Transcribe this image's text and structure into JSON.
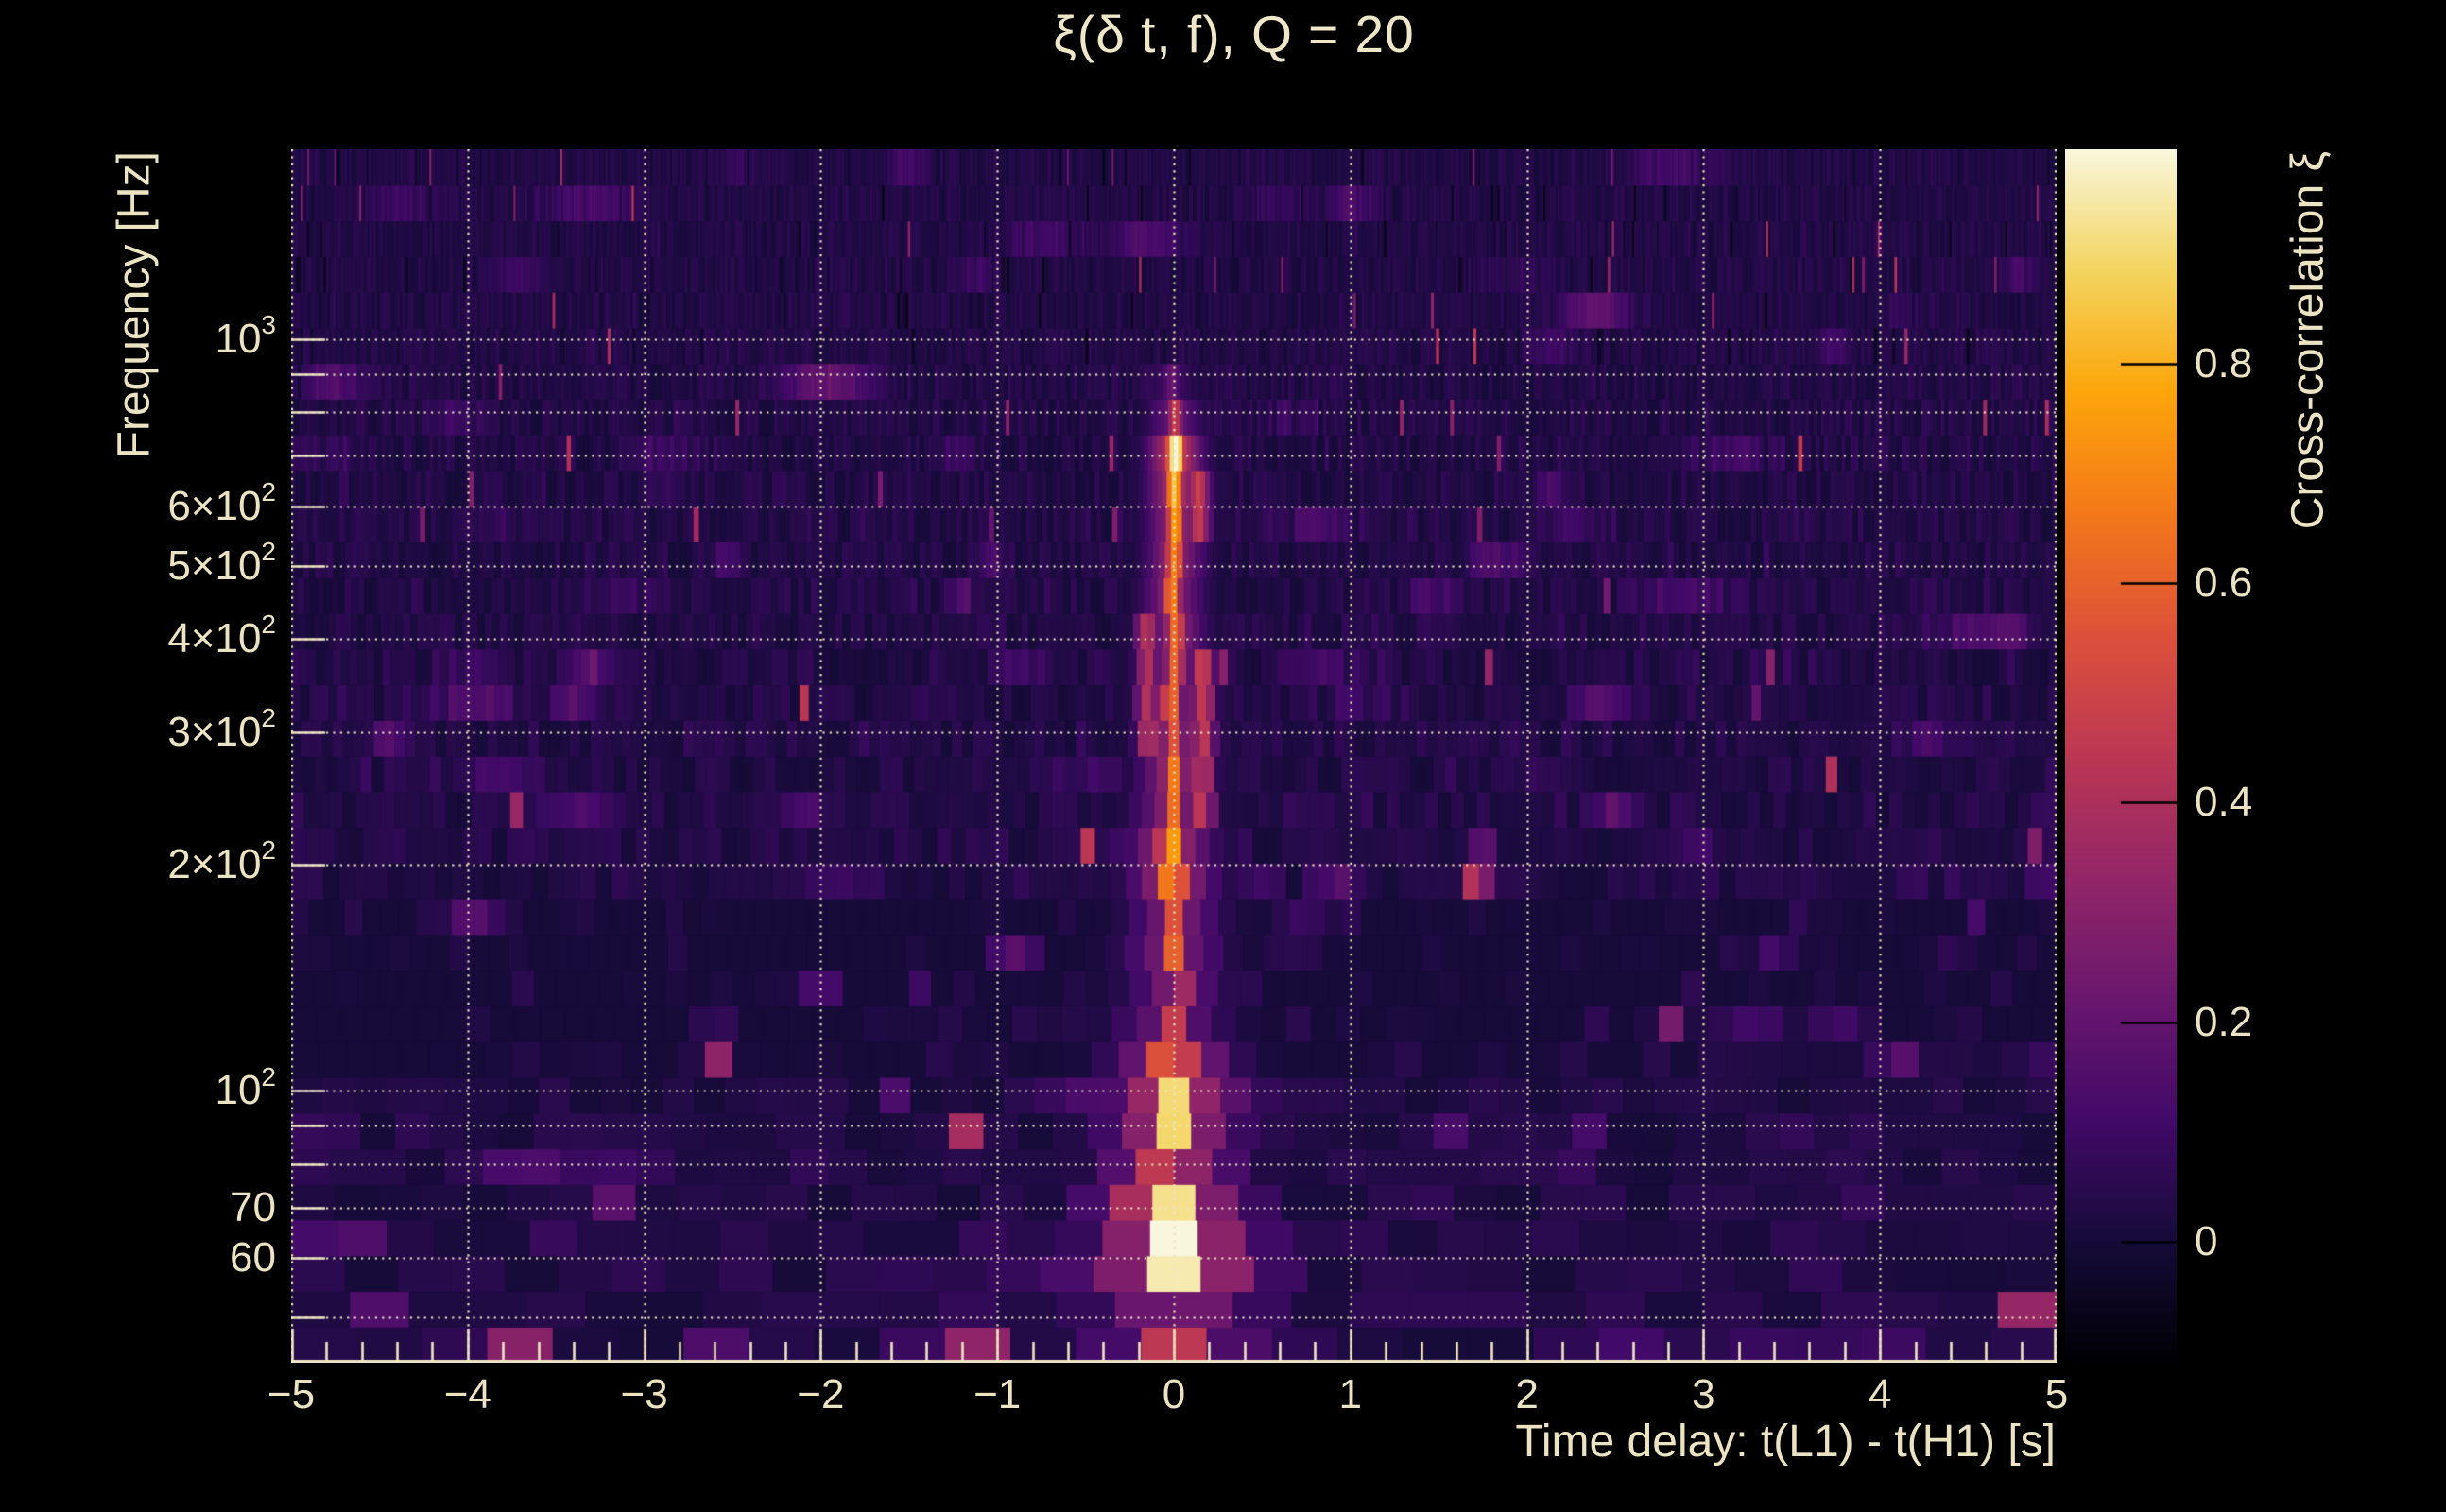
{
  "title": "ξ(δ t, f), Q = 20",
  "chart_data": {
    "type": "heatmap",
    "title": "ξ(δ t, f), Q = 20",
    "xlabel": "Time delay: t(L1) - t(H1) [s]",
    "ylabel": "Frequency [Hz]",
    "x_range": [
      -5,
      5
    ],
    "x_ticks": [
      {
        "v": -5,
        "label": "−5"
      },
      {
        "v": -4,
        "label": "−4"
      },
      {
        "v": -3,
        "label": "−3"
      },
      {
        "v": -2,
        "label": "−2"
      },
      {
        "v": -1,
        "label": "−1"
      },
      {
        "v": 0,
        "label": "0"
      },
      {
        "v": 1,
        "label": "1"
      },
      {
        "v": 2,
        "label": "2"
      },
      {
        "v": 3,
        "label": "3"
      },
      {
        "v": 4,
        "label": "4"
      },
      {
        "v": 5,
        "label": "5"
      }
    ],
    "x_minor_tick_step": 0.2,
    "y_scale": "log",
    "y_range": [
      43.5,
      1790
    ],
    "y_ticks": [
      {
        "f": 1000,
        "base": "10",
        "exp": "3"
      },
      {
        "f": 600,
        "base": "6×10",
        "exp": "2"
      },
      {
        "f": 500,
        "base": "5×10",
        "exp": "2"
      },
      {
        "f": 400,
        "base": "4×10",
        "exp": "2"
      },
      {
        "f": 300,
        "base": "3×10",
        "exp": "2"
      },
      {
        "f": 200,
        "base": "2×10",
        "exp": "2"
      },
      {
        "f": 100,
        "base": "10",
        "exp": "2"
      },
      {
        "f": 70,
        "base": "70",
        "exp": ""
      },
      {
        "f": 60,
        "base": "60",
        "exp": ""
      }
    ],
    "grid_freqs": [
      50,
      60,
      70,
      80,
      90,
      100,
      200,
      300,
      400,
      500,
      600,
      700,
      800,
      900,
      1000
    ],
    "grid_on": true,
    "colorbar": {
      "label": "Cross-correlation ξ",
      "vmin": -0.11,
      "vmax": 0.995,
      "ticks": [
        {
          "v": 0,
          "label": "0"
        },
        {
          "v": 0.2,
          "label": "0.2"
        },
        {
          "v": 0.4,
          "label": "0.4"
        },
        {
          "v": 0.6,
          "label": "0.6"
        },
        {
          "v": 0.8,
          "label": "0.8"
        }
      ],
      "colormap": "inferno",
      "colormap_stops": [
        [
          0.0,
          0,
          0,
          4
        ],
        [
          0.1,
          22,
          11,
          57
        ],
        [
          0.2,
          66,
          10,
          104
        ],
        [
          0.3,
          106,
          23,
          110
        ],
        [
          0.4,
          147,
          38,
          103
        ],
        [
          0.5,
          188,
          55,
          84
        ],
        [
          0.6,
          221,
          81,
          58
        ],
        [
          0.7,
          243,
          120,
          25
        ],
        [
          0.8,
          252,
          165,
          10
        ],
        [
          0.9,
          243,
          212,
          95
        ],
        [
          1.0,
          248,
          246,
          220
        ]
      ]
    },
    "signal": {
      "description": "Bright cross-correlation ridge at zero time delay spanning ~45-820 Hz",
      "main_ridge": {
        "t0": 0,
        "amplitude_profile": [
          [
            43,
            52,
            0.5
          ],
          [
            52,
            57,
            0.8
          ],
          [
            57,
            72,
            0.97
          ],
          [
            72,
            88,
            0.78
          ],
          [
            88,
            112,
            0.93
          ],
          [
            112,
            140,
            0.45
          ],
          [
            140,
            175,
            0.55
          ],
          [
            175,
            230,
            0.9
          ],
          [
            230,
            330,
            0.6
          ],
          [
            330,
            420,
            0.66
          ],
          [
            420,
            520,
            0.72
          ],
          [
            520,
            575,
            0.85
          ],
          [
            575,
            760,
            0.96
          ],
          [
            760,
            820,
            0.55
          ],
          [
            820,
            900,
            0.25
          ],
          [
            900,
            1800,
            0.03
          ]
        ]
      },
      "secondary_features": [
        {
          "t": -0.18,
          "f_lo": 55,
          "f_hi": 78,
          "amp": 0.55,
          "sigma": 0.07
        },
        {
          "t": -0.38,
          "f_lo": 52,
          "f_hi": 62,
          "amp": 0.38,
          "sigma": 0.05
        },
        {
          "t": 0.14,
          "f_lo": 540,
          "f_hi": 660,
          "amp": 0.5,
          "sigma": 0.045
        },
        {
          "t": -0.15,
          "f_lo": 290,
          "f_hi": 430,
          "amp": 0.45,
          "sigma": 0.045
        },
        {
          "t": 0.16,
          "f_lo": 230,
          "f_hi": 390,
          "amp": 0.48,
          "sigma": 0.05
        },
        {
          "t": -1.3,
          "f_lo": 43,
          "f_hi": 50,
          "amp": 0.52,
          "sigma": 0.1
        },
        {
          "t": -1.12,
          "f_lo": 43,
          "f_hi": 48,
          "amp": 0.3,
          "sigma": 0.07
        },
        {
          "t": 1.75,
          "f_lo": 180,
          "f_hi": 215,
          "amp": 0.32,
          "sigma": 0.035
        },
        {
          "t": 2.8,
          "f_lo": 108,
          "f_hi": 124,
          "amp": 0.3,
          "sigma": 0.03
        },
        {
          "t": 3.45,
          "f_lo": 43,
          "f_hi": 48,
          "amp": 0.55,
          "sigma": 0.06
        },
        {
          "t": -2.5,
          "f_lo": 43,
          "f_hi": 48,
          "amp": 0.48,
          "sigma": 0.06
        },
        {
          "t": 0.1,
          "f_lo": 43,
          "f_hi": 49,
          "amp": 0.6,
          "sigma": 0.09
        },
        {
          "t": 4.85,
          "f_lo": 46,
          "f_hi": 52,
          "amp": 0.32,
          "sigma": 0.06
        },
        {
          "t": -4.55,
          "f_lo": 48,
          "f_hi": 55,
          "amp": 0.26,
          "sigma": 0.05
        },
        {
          "t": -3.7,
          "f_lo": 43,
          "f_hi": 47,
          "amp": 0.3,
          "sigma": 0.05
        },
        {
          "t": 4.15,
          "f_lo": 44,
          "f_hi": 48,
          "amp": 0.28,
          "sigma": 0.05
        },
        {
          "t": -0.85,
          "f_lo": 43,
          "f_hi": 47,
          "amp": 0.3,
          "sigma": 0.04
        }
      ],
      "noise": {
        "base": 0.03,
        "sigma": 0.065,
        "dark_band_f": [
          110,
          190
        ],
        "rows": 34,
        "tiles_per_hz": 0.58,
        "seed": 9
      }
    }
  },
  "colors": {
    "background": "#000000",
    "text": "#ece3c3",
    "title_text": "#f0e7c8",
    "gridline": "#efe5c4",
    "axis_line": "#efe5c4",
    "colorbar_tick": "#000000"
  }
}
